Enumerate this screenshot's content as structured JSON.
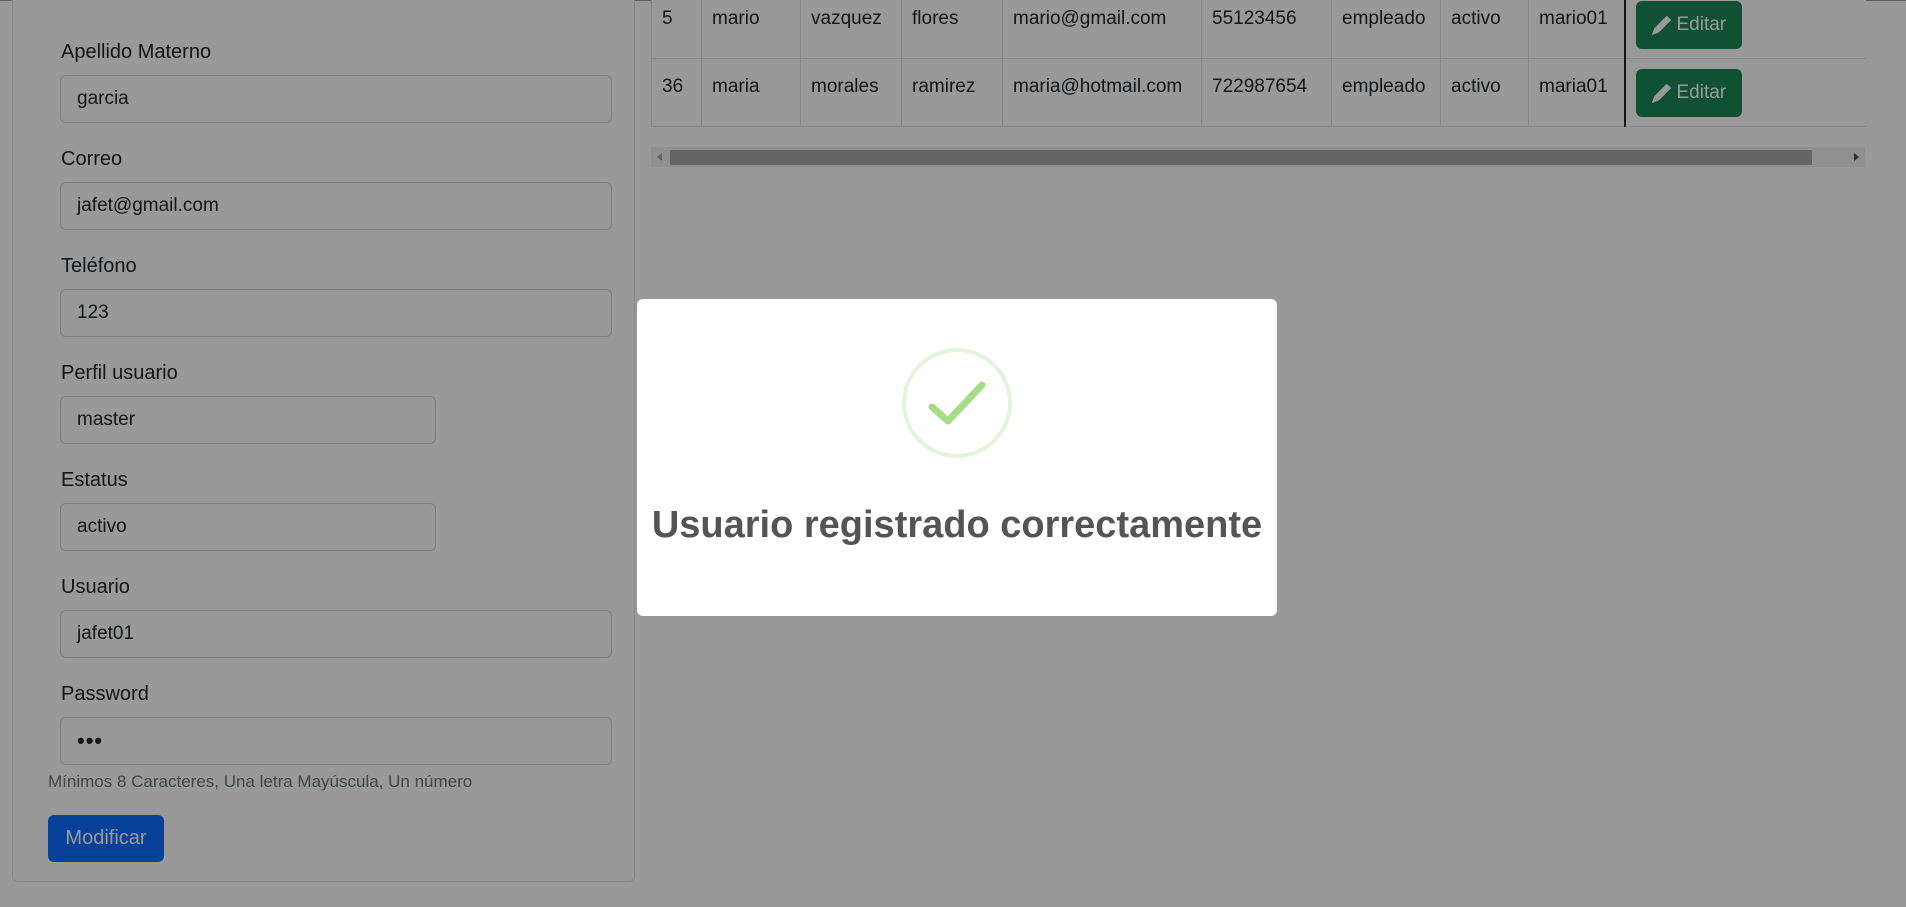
{
  "form": {
    "apellido_materno": {
      "label": "Apellido Materno",
      "value": "garcia"
    },
    "correo": {
      "label": "Correo",
      "value": "jafet@gmail.com"
    },
    "telefono": {
      "label": "Teléfono",
      "value": "123"
    },
    "perfil": {
      "label": "Perfil usuario",
      "value": "master"
    },
    "estatus": {
      "label": "Estatus",
      "value": "activo"
    },
    "usuario": {
      "label": "Usuario",
      "value": "jafet01"
    },
    "password": {
      "label": "Password",
      "value": "•••",
      "help": "Mínimos 8 Caracteres, Una letra Mayúscula, Un número"
    },
    "submit_label": "Modificar"
  },
  "table": {
    "rows": [
      {
        "id": "5",
        "nombre": "mario",
        "ap_paterno": "vazquez",
        "ap_materno": "flores",
        "correo": "mario@gmail.com",
        "telefono": "55123456",
        "perfil": "empleado",
        "estatus": "activo",
        "usuario": "mario01",
        "action": "Editar"
      },
      {
        "id": "36",
        "nombre": "maria",
        "ap_paterno": "morales",
        "ap_materno": "ramirez",
        "correo": "maria@hotmail.com",
        "telefono": "722987654",
        "perfil": "empleado",
        "estatus": "activo",
        "usuario": "maria01",
        "action": "Editar"
      }
    ]
  },
  "modal": {
    "title": "Usuario registrado correctamente",
    "icon": "success-check-icon"
  },
  "colors": {
    "primary": "#0d6efd",
    "success": "#198754",
    "check": "#a5dc86",
    "overlay": "rgba(0,0,0,0.4)"
  }
}
